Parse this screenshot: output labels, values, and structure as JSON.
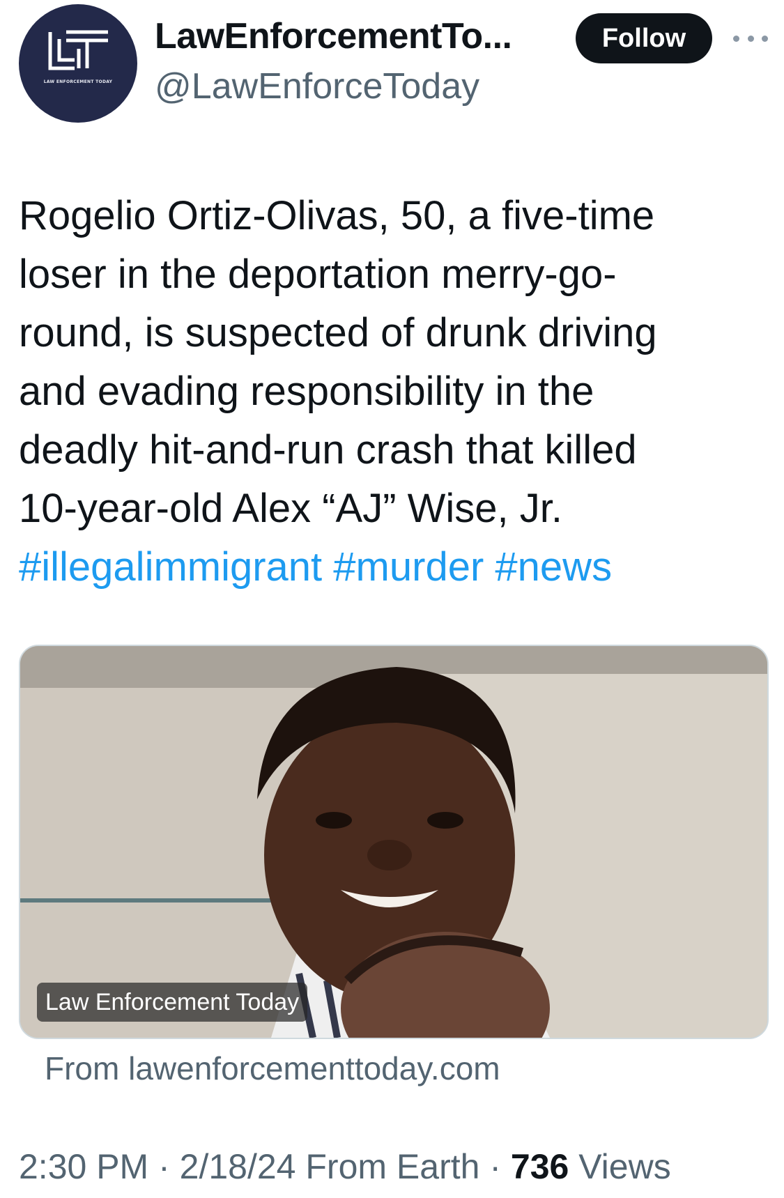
{
  "author": {
    "display_name": "LawEnforcementTo...",
    "handle": "@LawEnforceToday",
    "avatar_text": "LAW ENFORCEMENT TODAY",
    "avatar_icon": "let-logo-icon"
  },
  "actions": {
    "follow_label": "Follow",
    "more_icon": "more-options-icon"
  },
  "tweet": {
    "lines": [
      "Rogelio Ortiz-Olivas, 50, a five-time",
      "loser in the deportation merry-go-",
      "round, is suspected of drunk driving",
      "and evading responsibility in the",
      "deadly hit-and-run crash that killed",
      "10-year-old Alex “AJ” Wise, Jr."
    ],
    "hashtags": [
      "#illegalimmigrant",
      "#murder",
      "#news"
    ]
  },
  "card": {
    "label": "Law Enforcement Today",
    "source": "From lawenforcementtoday.com"
  },
  "meta": {
    "time": "2:30 PM",
    "separator": " · ",
    "date": "2/18/24",
    "location": "From Earth",
    "views_count": "736",
    "views_label": "Views"
  },
  "colors": {
    "accent": "#1d9bf0",
    "text": "#0f1419",
    "muted": "#536471",
    "avatar_bg": "#23294a"
  }
}
